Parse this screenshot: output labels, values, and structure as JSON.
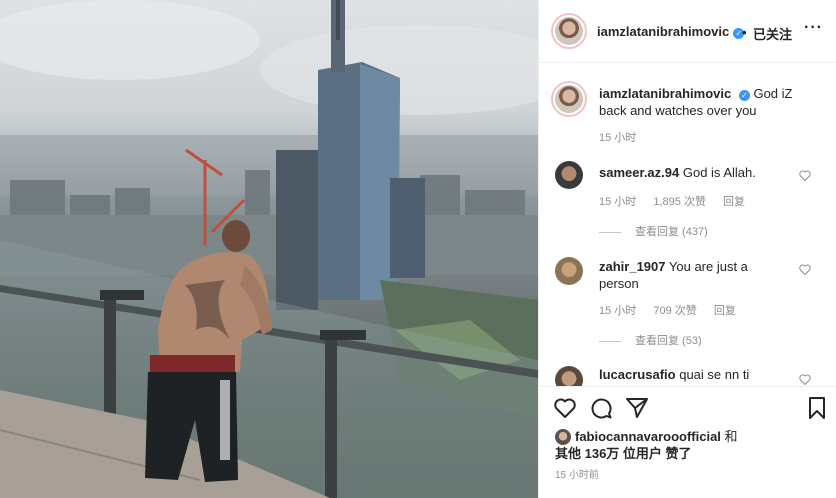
{
  "header": {
    "username": "iamzlatanibrahimovic",
    "verified_mark": "✓",
    "dot": "•",
    "follow_label": "已关注",
    "more_label": "···"
  },
  "post": {
    "author": "iamzlatanibrahimovic",
    "caption_line1": "God iZ",
    "caption_line2": "back and watches over you",
    "time": "15 小时"
  },
  "comments": [
    {
      "username": "sameer.az.94",
      "text": "God is Allah.",
      "time": "15 小时",
      "likes": "1,895 次赞",
      "reply": "回复",
      "view_replies": "查看回复 (437)"
    },
    {
      "username": "zahir_1907",
      "text_line1": "You are just a",
      "text_line2": "person",
      "time": "15 小时",
      "likes": "709 次赞",
      "reply": "回复",
      "view_replies": "查看回复 (53)"
    },
    {
      "username": "lucacrusafio",
      "text": "quai se nn ti"
    }
  ],
  "actions": {
    "like_icon": "heart-icon",
    "comment_icon": "comment-icon",
    "share_icon": "share-icon",
    "save_icon": "bookmark-icon"
  },
  "likes_summary": {
    "liker": "fabiocannavarooofficial",
    "and": "和",
    "others": "其他 136万 位用户 赞了"
  },
  "post_time": "15 小时前",
  "colors": {
    "verified": "#3897f0",
    "meta_gray": "#8e8e8e"
  }
}
